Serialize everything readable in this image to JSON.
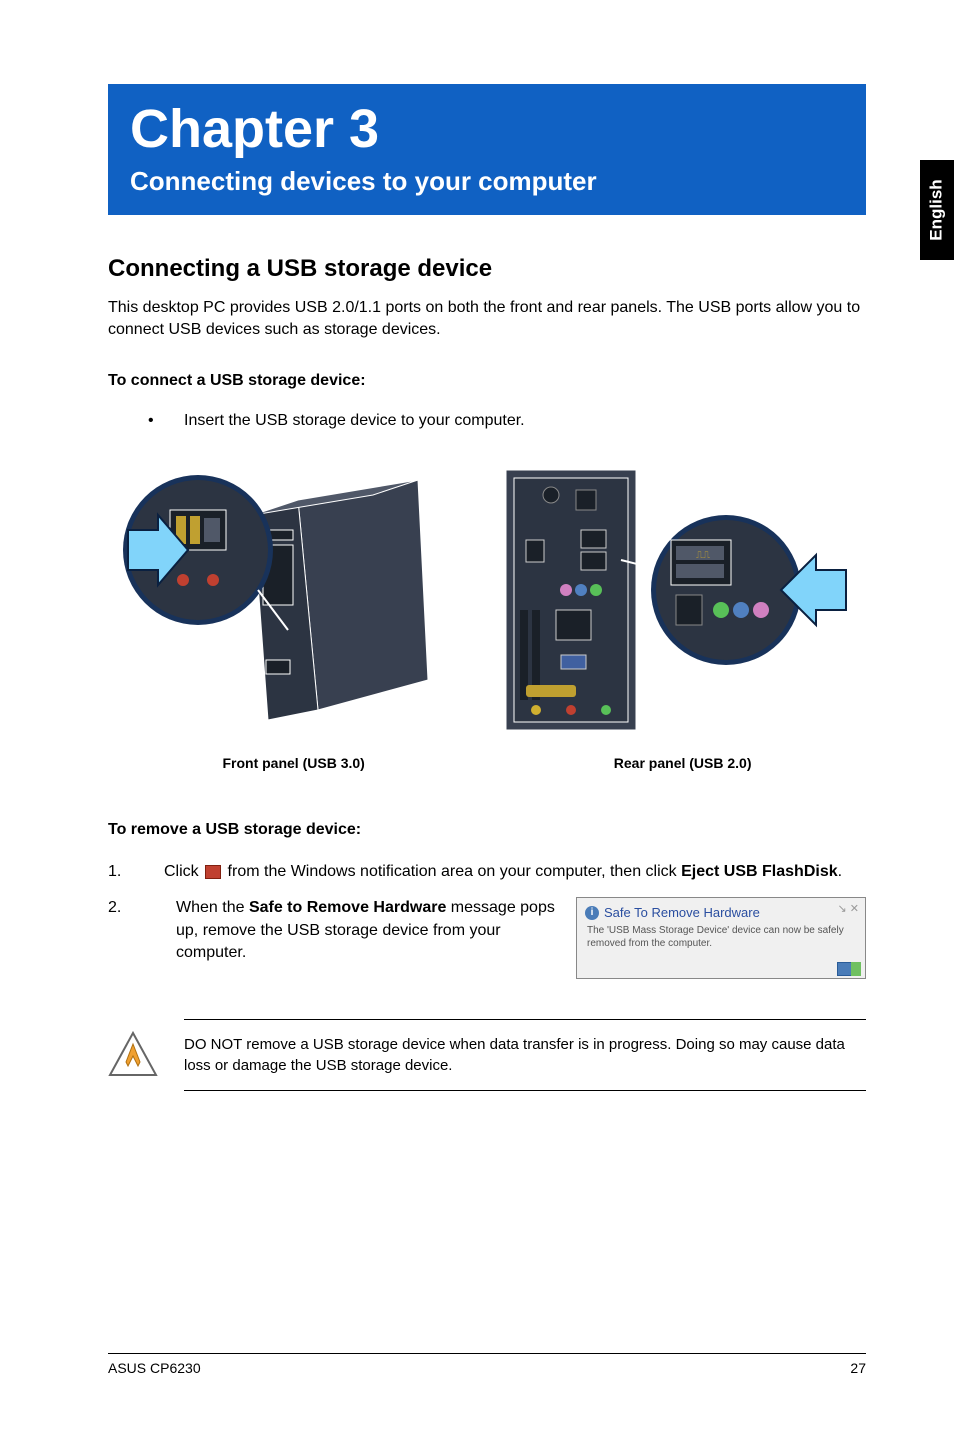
{
  "side_tab": "English",
  "chapter": {
    "title": "Chapter 3",
    "subtitle": "Connecting devices to your computer"
  },
  "section": {
    "heading": "Connecting a USB storage device",
    "intro": "This desktop PC provides USB 2.0/1.1 ports on both the front and rear panels. The USB ports allow you to connect USB devices such as storage devices."
  },
  "connect": {
    "heading": "To connect a USB storage device:",
    "bullet": "Insert the USB storage device to your computer."
  },
  "captions": {
    "front": "Front panel (USB 3.0)",
    "rear": "Rear panel (USB 2.0)"
  },
  "remove": {
    "heading": "To remove a USB storage device:",
    "step1_num": "1.",
    "step1_a": "Click ",
    "step1_b": " from the Windows notification area on your computer, then click ",
    "step1_c": "Eject USB FlashDisk",
    "step1_d": ".",
    "step2_num": "2.",
    "step2_a": "When the ",
    "step2_b": "Safe to Remove Hardware",
    "step2_c": " message pops up, remove the USB storage device from your computer."
  },
  "notification": {
    "title": "Safe To Remove Hardware",
    "body": "The 'USB Mass Storage Device' device can now be safely removed from the computer."
  },
  "warning": "DO NOT remove a USB storage device when data transfer is in progress. Doing so may cause data loss or damage the USB storage device.",
  "footer": {
    "left": "ASUS CP6230",
    "right": "27"
  }
}
